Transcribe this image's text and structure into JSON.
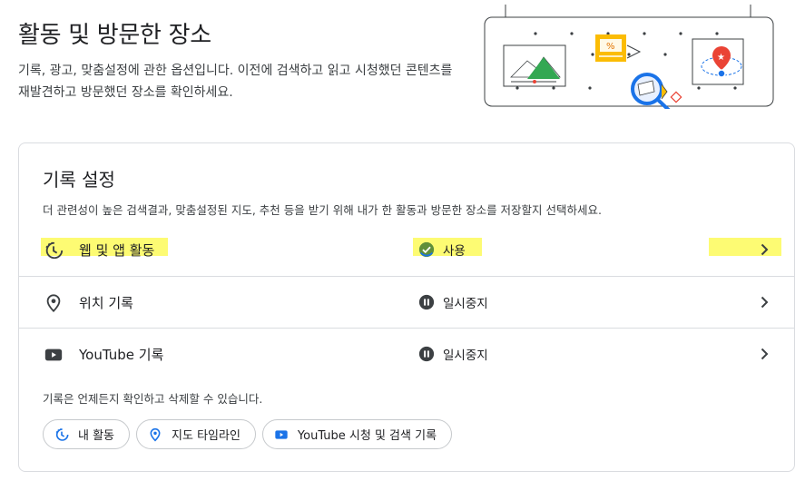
{
  "header": {
    "title": "활동 및 방문한 장소",
    "description": "기록, 광고, 맞춤설정에 관한 옵션입니다. 이전에 검색하고 읽고 시청했던 콘텐츠를 재발견하고 방문했던 장소를 확인하세요."
  },
  "history_settings": {
    "title": "기록 설정",
    "description": "더 관련성이 높은 검색결과, 맞춤설정된 지도, 추천 등을 받기 위해 내가 한 활동과 방문한 장소를 저장할지 선택하세요.",
    "rows": [
      {
        "label": "웹 및 앱 활동",
        "status": "사용",
        "icon": "history-icon",
        "status_icon": "check-circle-icon"
      },
      {
        "label": "위치 기록",
        "status": "일시중지",
        "icon": "location-pin-icon",
        "status_icon": "pause-circle-icon"
      },
      {
        "label": "YouTube 기록",
        "status": "일시중지",
        "icon": "youtube-icon",
        "status_icon": "pause-circle-icon"
      }
    ],
    "footer": "기록은 언제든지 확인하고 삭제할 수 있습니다.",
    "chips": [
      {
        "label": "내 활동",
        "icon": "history-icon"
      },
      {
        "label": "지도 타임라인",
        "icon": "location-pin-icon"
      },
      {
        "label": "YouTube 시청 및 검색 기록",
        "icon": "youtube-icon"
      }
    ]
  },
  "colors": {
    "highlight": "#fdfa5a",
    "accent_blue": "#1a73e8",
    "check_green": "#5f8f3a",
    "icon_dark": "#3c4043"
  }
}
